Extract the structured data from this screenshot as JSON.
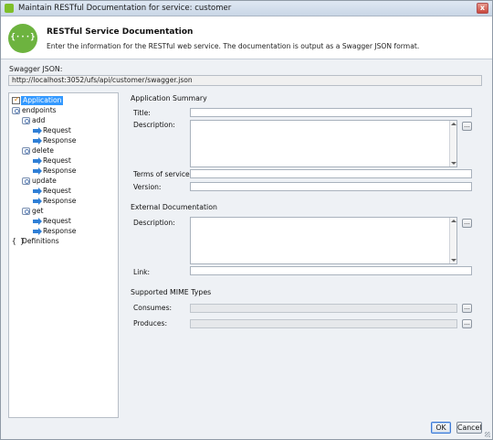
{
  "window": {
    "title": "Maintain RESTful Documentation for service: customer",
    "close_glyph": "x"
  },
  "header": {
    "logo_text": "{···}",
    "title": "RESTful Service Documentation",
    "description": "Enter the information for the RESTful web service. The documentation is output as a Swagger JSON format."
  },
  "swagger": {
    "label": "Swagger JSON:",
    "url": "http://localhost:3052/ufs/api/customer/swagger.json"
  },
  "tree": {
    "items": [
      {
        "label": "Application",
        "icon": "edit-check-icon",
        "selected": true
      },
      {
        "label": "endpoints",
        "icon": "endpoint-icon"
      },
      {
        "label": "add",
        "icon": "endpoint-icon"
      },
      {
        "label": "Request",
        "icon": "arrow-right-icon"
      },
      {
        "label": "Response",
        "icon": "arrow-right-icon"
      },
      {
        "label": "delete",
        "icon": "endpoint-icon"
      },
      {
        "label": "Request",
        "icon": "arrow-right-icon"
      },
      {
        "label": "Response",
        "icon": "arrow-right-icon"
      },
      {
        "label": "update",
        "icon": "endpoint-icon"
      },
      {
        "label": "Request",
        "icon": "arrow-right-icon"
      },
      {
        "label": "Response",
        "icon": "arrow-right-icon"
      },
      {
        "label": "get",
        "icon": "endpoint-icon"
      },
      {
        "label": "Request",
        "icon": "arrow-right-icon"
      },
      {
        "label": "Response",
        "icon": "arrow-right-icon"
      },
      {
        "label": "Definitions",
        "icon": "braces-icon",
        "icon_text": "{ }"
      }
    ]
  },
  "form": {
    "app_summary": {
      "section": "Application Summary",
      "title_label": "Title:",
      "title_value": "",
      "description_label": "Description:",
      "description_value": "",
      "terms_label": "Terms of service:",
      "terms_value": "",
      "version_label": "Version:",
      "version_value": ""
    },
    "external_docs": {
      "section": "External Documentation",
      "description_label": "Description:",
      "description_value": "",
      "link_label": "Link:",
      "link_value": ""
    },
    "mime": {
      "section": "Supported MIME Types",
      "consumes_label": "Consumes:",
      "consumes_value": "",
      "produces_label": "Produces:",
      "produces_value": ""
    },
    "ellipsis_label": "..."
  },
  "buttons": {
    "ok": "OK",
    "cancel": "Cancel"
  },
  "colors": {
    "selection": "#3399ff",
    "logo": "#6db33f",
    "arrow": "#2f7fd6"
  }
}
